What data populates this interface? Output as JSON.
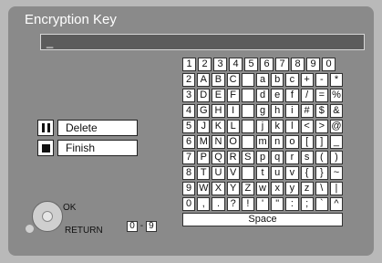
{
  "window": {
    "title": "Encryption Key",
    "entry_text": "_"
  },
  "actions": {
    "delete_label": "Delete",
    "finish_label": "Finish"
  },
  "keyboard": {
    "rows": [
      [
        "1",
        "2",
        "3",
        "4",
        "5",
        "6",
        "7",
        "8",
        "9",
        "0"
      ],
      [
        "2",
        "A",
        "B",
        "C",
        "",
        "a",
        "b",
        "c",
        "+",
        "-",
        "*"
      ],
      [
        "3",
        "D",
        "E",
        "F",
        "",
        "d",
        "e",
        "f",
        "/",
        "=",
        "%"
      ],
      [
        "4",
        "G",
        "H",
        "I",
        "",
        "g",
        "h",
        "i",
        "#",
        "$",
        "&"
      ],
      [
        "5",
        "J",
        "K",
        "L",
        "",
        "j",
        "k",
        "l",
        "<",
        ">",
        "@"
      ],
      [
        "6",
        "M",
        "N",
        "O",
        "",
        "m",
        "n",
        "o",
        "[",
        "]",
        "_"
      ],
      [
        "7",
        "P",
        "Q",
        "R",
        "S",
        "p",
        "q",
        "r",
        "s",
        "(",
        ")"
      ],
      [
        "8",
        "T",
        "U",
        "V",
        "",
        "t",
        "u",
        "v",
        "{",
        "}",
        "~"
      ],
      [
        "9",
        "W",
        "X",
        "Y",
        "Z",
        "w",
        "x",
        "y",
        "z",
        "\\",
        "|"
      ]
    ],
    "last_row_key": "0",
    "last_row_symbols": [
      ",",
      ".",
      "?",
      "!",
      "'",
      "\"",
      ":",
      ";",
      "`",
      "^"
    ],
    "space_label": "Space"
  },
  "hints": {
    "ok": "OK",
    "return": "RETURN",
    "range_from": "0",
    "range_sep": "-",
    "range_to": "9"
  }
}
